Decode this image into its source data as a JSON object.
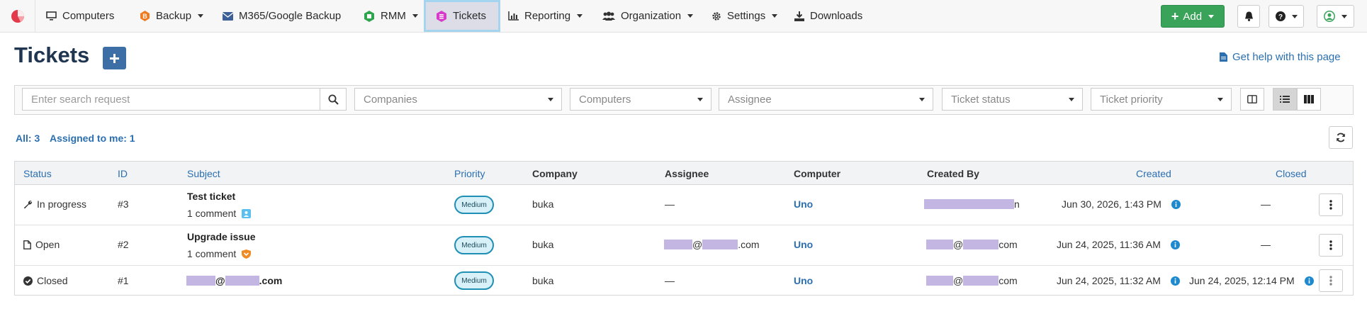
{
  "nav": {
    "items": [
      {
        "label": "Computers",
        "icon": "monitor-icon"
      },
      {
        "label": "Backup",
        "icon": "backup-icon"
      },
      {
        "label": "M365/Google Backup",
        "icon": "envelope-icon"
      },
      {
        "label": "RMM",
        "icon": "rmm-icon"
      },
      {
        "label": "Tickets",
        "icon": "tickets-icon"
      },
      {
        "label": "Reporting",
        "icon": "bar-chart-icon"
      },
      {
        "label": "Organization",
        "icon": "users-icon"
      },
      {
        "label": "Settings",
        "icon": "gear-icon"
      },
      {
        "label": "Downloads",
        "icon": "download-icon"
      }
    ],
    "active": "Tickets",
    "add_label": "Add"
  },
  "page": {
    "title": "Tickets",
    "help_link": "Get help with this page"
  },
  "filters": {
    "search_placeholder": "Enter search request",
    "companies": "Companies",
    "computers": "Computers",
    "assignee": "Assignee",
    "status": "Ticket status",
    "priority": "Ticket priority"
  },
  "counts": {
    "all": "All: 3",
    "assigned": "Assigned to me: 1"
  },
  "table": {
    "columns": [
      "Status",
      "ID",
      "Subject",
      "Priority",
      "Company",
      "Assignee",
      "Computer",
      "Created By",
      "Created",
      "Closed"
    ],
    "rows": [
      {
        "status": "In progress",
        "status_icon": "wrench-icon",
        "id": "#3",
        "subject": "Test ticket",
        "comments": "1 comment",
        "comment_icon_color": "#5bc0f0",
        "priority": "Medium",
        "company": "buka",
        "assignee": "—",
        "computer": "Uno",
        "created_by_suffix": "n",
        "created": "Jun 30, 2026, 1:43 PM",
        "closed": "—"
      },
      {
        "status": "Open",
        "status_icon": "file-icon",
        "id": "#2",
        "subject": "Upgrade issue",
        "comments": "1 comment",
        "comment_icon_color": "#f08a24",
        "priority": "Medium",
        "company": "buka",
        "assignee_at": "@",
        "assignee_suffix": ".com",
        "computer": "Uno",
        "created_by_at": "@",
        "created_by_suffix": "com",
        "created": "Jun 24, 2025, 11:36 AM",
        "closed": "—"
      },
      {
        "status": "Closed",
        "status_icon": "check-circle-icon",
        "id": "#1",
        "subject_at": "@",
        "subject_suffix": ".com",
        "priority": "Medium",
        "company": "buka",
        "assignee": "—",
        "computer": "Uno",
        "created_by_at": "@",
        "created_by_suffix": "com",
        "created": "Jun 24, 2025, 11:32 AM",
        "closed": "Jun 24, 2025, 12:14 PM"
      }
    ]
  }
}
